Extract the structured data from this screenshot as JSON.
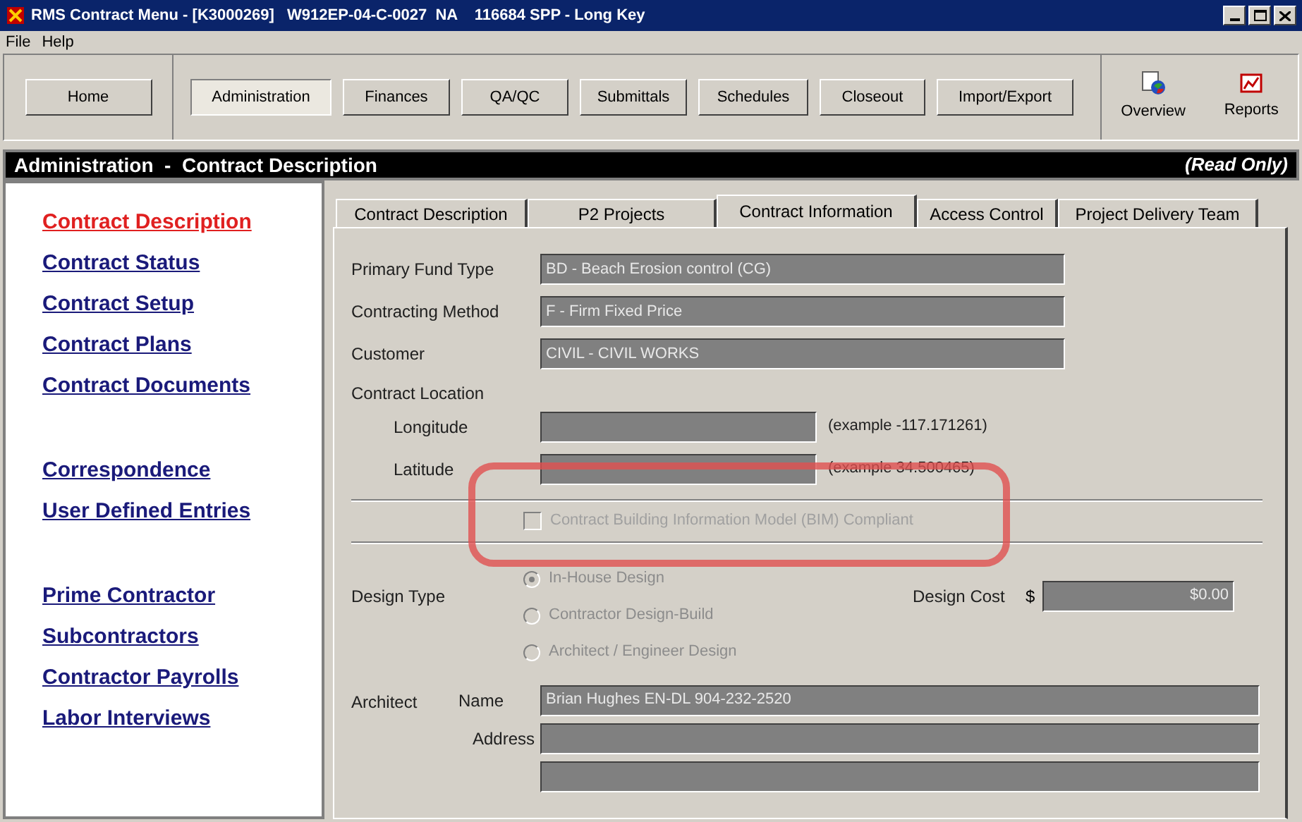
{
  "window": {
    "title": "RMS Contract Menu - [K3000269]   W912EP-04-C-0027  NA    116684 SPP - Long Key"
  },
  "menu": [
    "File",
    "Help"
  ],
  "toolbar": {
    "home": "Home",
    "buttons": [
      {
        "label": "Administration",
        "selected": true
      },
      {
        "label": "Finances",
        "selected": false
      },
      {
        "label": "QA/QC",
        "selected": false
      },
      {
        "label": "Submittals",
        "selected": false
      },
      {
        "label": "Schedules",
        "selected": false
      },
      {
        "label": "Closeout",
        "selected": false
      },
      {
        "label": "Import/Export",
        "selected": false
      }
    ],
    "tools": [
      {
        "label": "Overview",
        "kind": "overview"
      },
      {
        "label": "Reports",
        "kind": "reports"
      }
    ]
  },
  "header": {
    "title": "Administration  -  Contract Description",
    "mode": "(Read Only)"
  },
  "sidebar": {
    "groups": [
      [
        {
          "label": "Contract Description",
          "selected": true
        },
        {
          "label": "Contract Status",
          "selected": false
        },
        {
          "label": "Contract Setup",
          "selected": false
        },
        {
          "label": "Contract Plans",
          "selected": false
        },
        {
          "label": "Contract Documents",
          "selected": false
        }
      ],
      [
        {
          "label": "Correspondence",
          "selected": false
        },
        {
          "label": "User Defined Entries",
          "selected": false
        }
      ],
      [
        {
          "label": "Prime Contractor",
          "selected": false
        },
        {
          "label": "Subcontractors",
          "selected": false
        },
        {
          "label": "Contractor Payrolls",
          "selected": false
        },
        {
          "label": "Labor Interviews",
          "selected": false
        }
      ]
    ]
  },
  "tabs": [
    {
      "label": "Contract Description",
      "selected": false
    },
    {
      "label": "P2 Projects",
      "selected": false
    },
    {
      "label": "Contract Information",
      "selected": true
    },
    {
      "label": "Access Control",
      "selected": false
    },
    {
      "label": "Project Delivery Team",
      "selected": false
    }
  ],
  "form": {
    "fields": [
      {
        "label": "Primary Fund Type",
        "value": "BD - Beach Erosion control (CG)"
      },
      {
        "label": "Contracting Method",
        "value": "F - Firm Fixed Price"
      },
      {
        "label": "Customer",
        "value": "CIVIL - CIVIL WORKS"
      }
    ],
    "location": {
      "label": "Contract Location",
      "coords": [
        {
          "label": "Longitude",
          "hint": "(example -117.171261)"
        },
        {
          "label": "Latitude",
          "hint": "(example 34.500465)"
        }
      ]
    },
    "bim": {
      "label": "Contract Building Information Model (BIM) Compliant",
      "checked": false,
      "disabled": true
    },
    "design_type": {
      "label": "Design Type",
      "options": [
        {
          "label": "In-House Design",
          "selected": true
        },
        {
          "label": "Contractor Design-Build",
          "selected": false
        },
        {
          "label": "Architect / Engineer Design",
          "selected": false
        }
      ]
    },
    "design_cost": {
      "label": "Design Cost",
      "currency": "$",
      "value": "$0.00"
    },
    "architect": {
      "label": "Architect",
      "name_label": "Name",
      "name": "Brian Hughes EN-DL 904-232-2520",
      "address_label": "Address"
    }
  },
  "annotation": {
    "kind": "highlight"
  }
}
